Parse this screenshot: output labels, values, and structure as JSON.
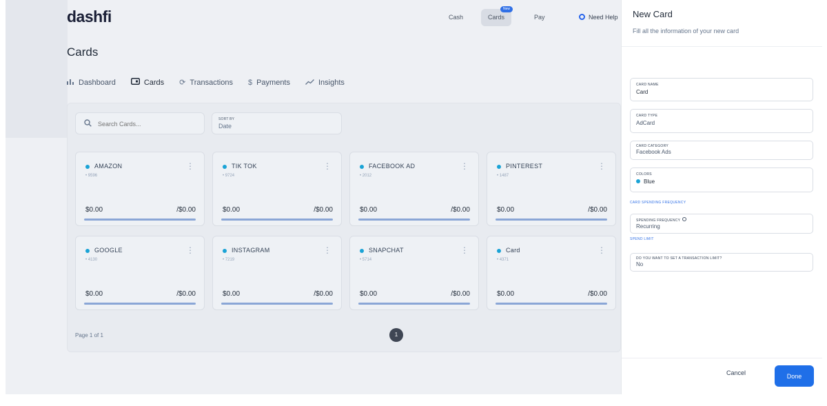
{
  "app": {
    "logo": "dashfi"
  },
  "topnav": {
    "items": [
      {
        "label": "Cash"
      },
      {
        "label": "Cards",
        "badge": "New"
      },
      {
        "label": "Pay"
      }
    ],
    "help": "Need Help"
  },
  "page": {
    "title": "Cards"
  },
  "tabs": [
    {
      "label": "Dashboard",
      "icon": "bar-chart-icon"
    },
    {
      "label": "Cards",
      "icon": "card-icon"
    },
    {
      "label": "Transactions",
      "icon": "refresh-icon"
    },
    {
      "label": "Payments",
      "icon": "dollar-icon"
    },
    {
      "label": "Insights",
      "icon": "trend-icon"
    }
  ],
  "search": {
    "placeholder": "Search Cards..."
  },
  "sort": {
    "label": "SORT BY",
    "value": "Date"
  },
  "cards": [
    {
      "name": "AMAZON",
      "number": "• 9596",
      "spent": "$0.00",
      "limit": "/$0.00"
    },
    {
      "name": "TIK TOK",
      "number": "• 9724",
      "spent": "$0.00",
      "limit": "/$0.00"
    },
    {
      "name": "FACEBOOK AD",
      "number": "• 2012",
      "spent": "$0.00",
      "limit": "/$0.00"
    },
    {
      "name": "PINTEREST",
      "number": "• 1487",
      "spent": "$0.00",
      "limit": "/$0.00"
    },
    {
      "name": "GOOGLE",
      "number": "• 4130",
      "spent": "$0.00",
      "limit": "/$0.00"
    },
    {
      "name": "INSTAGRAM",
      "number": "• 7219",
      "spent": "$0.00",
      "limit": "/$0.00"
    },
    {
      "name": "SNAPCHAT",
      "number": "• 5714",
      "spent": "$0.00",
      "limit": "/$0.00"
    },
    {
      "name": "Card",
      "number": "• 4371",
      "spent": "$0.00",
      "limit": "/$0.00"
    }
  ],
  "pagination": {
    "info": "Page 1 of 1",
    "current": "1"
  },
  "drawer": {
    "title": "New Card",
    "subtitle": "Fill all the information of your new card",
    "fields": {
      "card_name": {
        "label": "CARD NAME",
        "value": "Card"
      },
      "card_type": {
        "label": "CARD TYPE",
        "value": "AdCard"
      },
      "card_category": {
        "label": "CARD CATEGORY",
        "value": "Facebook Ads"
      },
      "colors": {
        "label": "COLORS",
        "value": "Blue"
      },
      "spending_frequency": {
        "label": "SPENDING FREQUENCY",
        "value": "Recurring"
      },
      "transaction_limit": {
        "label": "DO YOU WANT TO SET A TRANSACTION LIMIT?",
        "value": "No"
      }
    },
    "sections": {
      "frequency": "CARD SPENDING FREQUENCY",
      "limit": "SPEND LIMIT"
    },
    "cancel": "Cancel",
    "done": "Done"
  },
  "colors": {
    "accent": "#1f6fe8",
    "card_dot": "#1aa3d6"
  }
}
